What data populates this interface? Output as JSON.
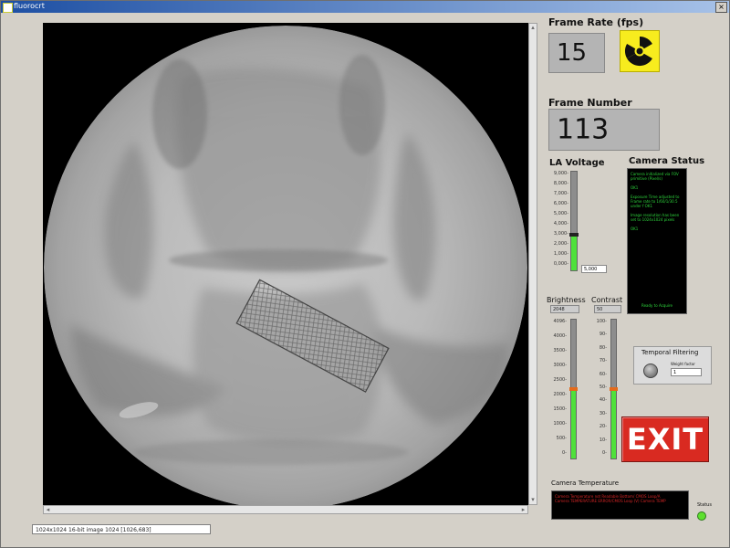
{
  "window": {
    "title": "fluorocrt",
    "close_glyph": "×"
  },
  "viewer": {
    "image_description_icon": "fluoroscopy-image"
  },
  "statusbar": {
    "text": "1024x1024 16-bit image 1024     [1026,683]"
  },
  "frame_rate": {
    "label": "Frame Rate (fps)",
    "value": "15"
  },
  "frame_number": {
    "label": "Frame Number",
    "value": "113"
  },
  "radiation_icon": "radiation-icon",
  "la_voltage": {
    "label": "LA Voltage",
    "scale": [
      "9,000-",
      "8,000-",
      "7,000-",
      "6,000-",
      "5,000-",
      "4,000-",
      "3,000-",
      "2,000-",
      "1,000-",
      "0,000-"
    ],
    "value": "5,000",
    "level": 0.36
  },
  "camera_status": {
    "title": "Camera Status",
    "lines": [
      "Camera initialized via FOV primitive (Pixel/s)",
      "OK1",
      "Exposure Time adjusted to Frame rate to 1/60/1/30.5 under f OK1",
      "Image resolution has been set to 1024x1024 pixels",
      "OK1"
    ],
    "footer": "Ready to Acquire"
  },
  "brightness": {
    "label": "Brightness",
    "value": "2048",
    "scale": [
      "4096-",
      "4000-",
      "3500-",
      "3000-",
      "2500-",
      "2000-",
      "1500-",
      "1000-",
      "500-",
      "0-"
    ],
    "level": 0.5
  },
  "contrast": {
    "label": "Contrast",
    "value": "50",
    "scale": [
      "100-",
      "90-",
      "80-",
      "70-",
      "60-",
      "50-",
      "40-",
      "30-",
      "20-",
      "10-",
      "0-"
    ],
    "level": 0.5
  },
  "temporal_filtering": {
    "label": "Temporal Filtering",
    "weight_label": "Weight factor",
    "weight_value": "1"
  },
  "exit_button": {
    "label": "EXIT"
  },
  "camera_temperature": {
    "label": "Camera Temperature",
    "lines": [
      "Camera Temperature not Readable Bottom/ CMOS Loop/A",
      "Camera TEMPERATURE ERROR/CMOS Loop (V) Camera TEMP"
    ]
  },
  "status": {
    "label": "Status"
  },
  "colors": {
    "accent_green": "#4fe13b",
    "exit_red": "#d92a21",
    "radiation_yellow": "#f7ec1e"
  }
}
